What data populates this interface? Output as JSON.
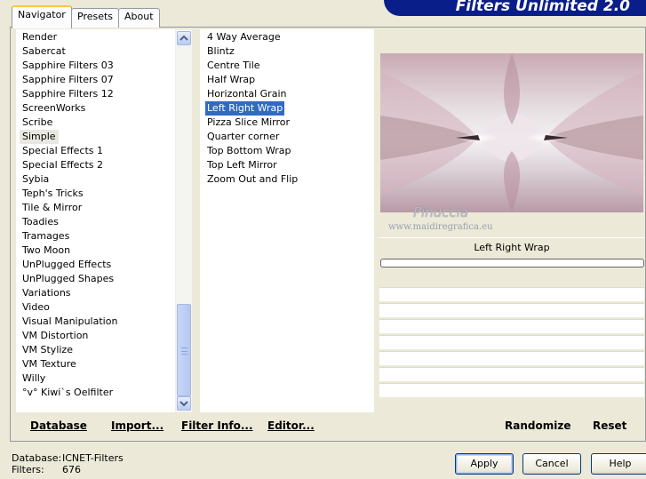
{
  "banner": {
    "title": "Filters Unlimited 2.0"
  },
  "tabs": [
    {
      "label": "Navigator",
      "active": true
    },
    {
      "label": "Presets",
      "active": false
    },
    {
      "label": "About",
      "active": false
    }
  ],
  "categories": {
    "items": [
      "Render",
      "Sabercat",
      "Sapphire Filters 03",
      "Sapphire Filters 07",
      "Sapphire Filters 12",
      "ScreenWorks",
      "Scribe",
      "Simple",
      "Special Effects 1",
      "Special Effects 2",
      "Sybia",
      "Teph's Tricks",
      "Tile & Mirror",
      "Toadies",
      "Tramages",
      "Two Moon",
      "UnPlugged Effects",
      "UnPlugged Shapes",
      "Variations",
      "Video",
      "Visual Manipulation",
      "VM Distortion",
      "VM Stylize",
      "VM Texture",
      "Willy",
      "°v° Kiwi`s Oelfilter"
    ],
    "selected": "Simple"
  },
  "filters": {
    "items": [
      "4 Way Average",
      "Blintz",
      "Centre Tile",
      "Half Wrap",
      "Horizontal Grain",
      "Left Right Wrap",
      "Pizza Slice Mirror",
      "Quarter corner",
      "Top Bottom Wrap",
      "Top Left Mirror",
      "Zoom Out and Flip"
    ],
    "selected": "Left Right Wrap"
  },
  "preview": {
    "watermark_name": "Pinuccia",
    "watermark_site": "www.maidiregrafica.eu"
  },
  "current_filter_name": "Left Right Wrap",
  "progress": 0,
  "toolbar": {
    "database": "Database",
    "import": "Import...",
    "filter_info": "Filter Info...",
    "editor": "Editor...",
    "randomize": "Randomize",
    "reset": "Reset"
  },
  "status": {
    "database_label": "Database:",
    "database_value": "ICNET-Filters",
    "filters_label": "Filters:",
    "filters_value": "676"
  },
  "buttons": {
    "apply": "Apply",
    "cancel": "Cancel",
    "help": "Help"
  },
  "colors": {
    "selection": "#316ac5",
    "banner": "#0a1e8a",
    "tab_highlight": "#ffc83c"
  }
}
